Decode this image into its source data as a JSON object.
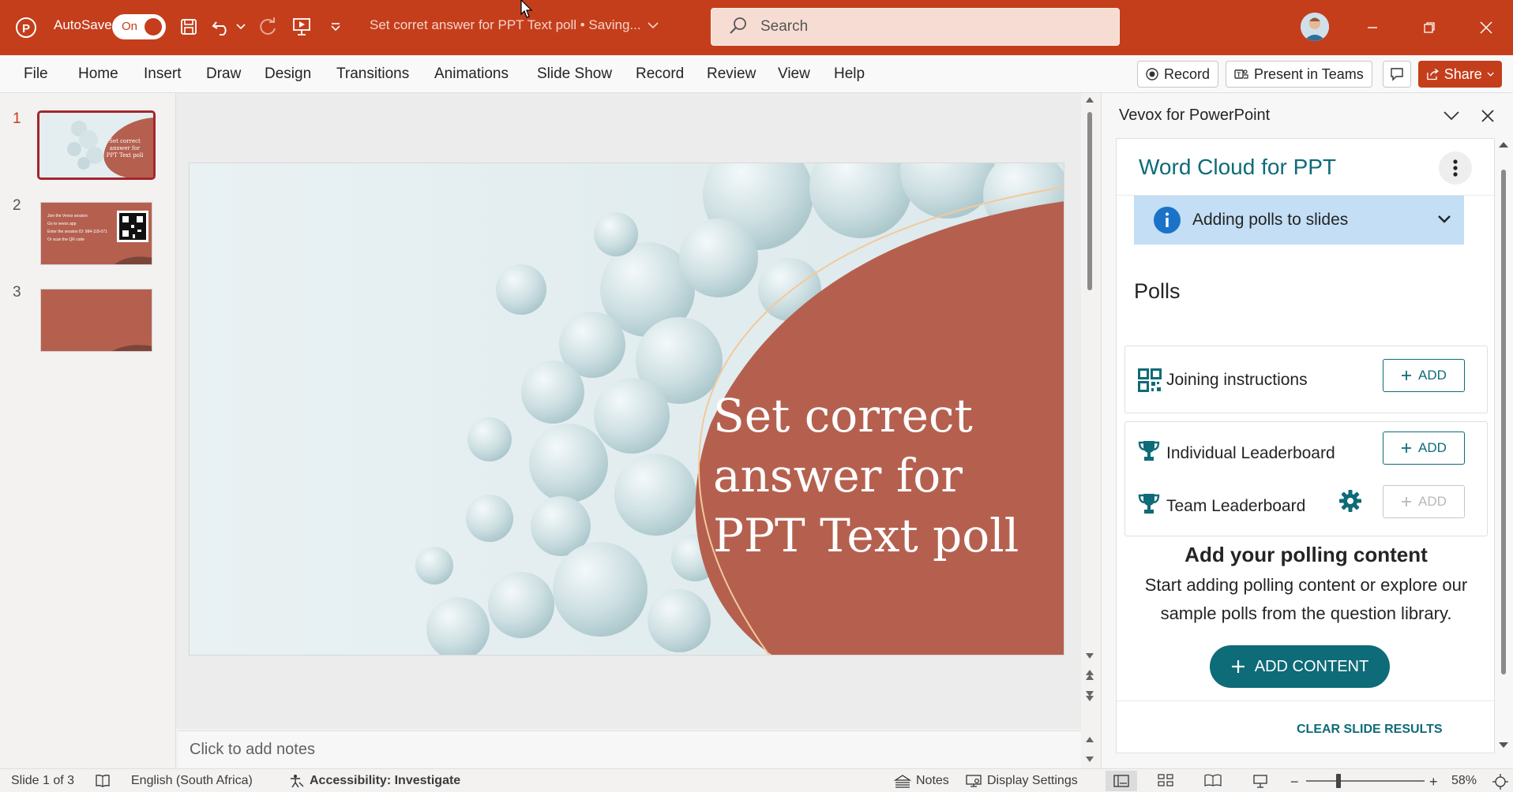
{
  "titlebar": {
    "autosave_label": "AutoSave",
    "autosave_state": "On",
    "doc_title": "Set corret answer for PPT Text poll • Saving...",
    "search_placeholder": "Search",
    "bg_color": "#c43e1c"
  },
  "ribbon": {
    "tabs": [
      "File",
      "Home",
      "Insert",
      "Draw",
      "Design",
      "Transitions",
      "Animations",
      "Slide Show",
      "Record",
      "Review",
      "View",
      "Help"
    ],
    "record_label": "Record",
    "present_label": "Present in Teams",
    "share_label": "Share"
  },
  "slides": {
    "numbers": [
      "1",
      "2",
      "3"
    ],
    "thumb1_text": "Set correct answer for PPT Text poll",
    "thumb2_lines": [
      "Join the Vevox session",
      "Go to vevox.app",
      "Enter the session ID: 984-118-071",
      "Or scan the QR code"
    ]
  },
  "slide": {
    "title": "Set correct answer for PPT Text poll",
    "shape_color": "#b5604f"
  },
  "notes": {
    "placeholder": "Click to add notes"
  },
  "pane": {
    "title": "Vevox for PowerPoint",
    "addin_title": "Word Cloud for PPT",
    "info_text": "Adding polls to slides",
    "polls_heading": "Polls",
    "items": {
      "joining": "Joining instructions",
      "individual": "Individual Leaderboard",
      "team": "Team Leaderboard"
    },
    "add_label": "ADD",
    "content_heading": "Add your polling content",
    "content_text": "Start adding polling content or explore our sample polls from the question library.",
    "add_content_label": "ADD CONTENT",
    "clear_label": "CLEAR SLIDE RESULTS",
    "accent_color": "#0e6b78"
  },
  "status": {
    "slide_count": "Slide 1 of 3",
    "language": "English (South Africa)",
    "accessibility": "Accessibility: Investigate",
    "notes_label": "Notes",
    "display_label": "Display Settings",
    "zoom": "58%"
  }
}
